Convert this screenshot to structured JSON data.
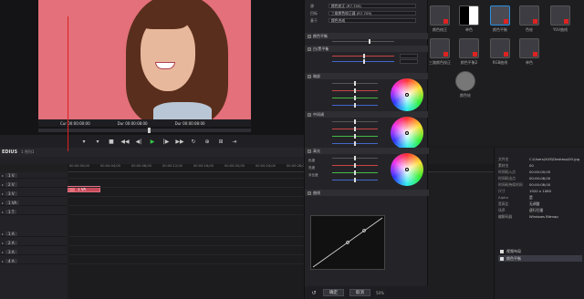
{
  "preview": {
    "in_label": "Cur 00:00:00:00",
    "out_label": "Dur 00:00:08:00",
    "right_label": "Dur 00:00:08:00"
  },
  "timeline": {
    "project_label": "EDIUS",
    "sequence_label": "1 序列1",
    "ruler_ticks": [
      "00:00:00;00",
      "00:00:04;00",
      "00:00:08;00",
      "00:00:12;00",
      "00:00:16;00",
      "00:00:20;00",
      "00:00:24;00",
      "00:00:28;00"
    ],
    "tracks": [
      "1 V",
      "2 V",
      "3 V",
      "1 VA",
      "1 T",
      "1 A",
      "2 A",
      "3 A",
      "4 A"
    ],
    "clip_name": "1 VA"
  },
  "fx_panel": {
    "rows": [
      {
        "name": "源",
        "value": "颜色校正 (R7.709)"
      },
      {
        "name": "目标",
        "value": "三维颜色校正器 (R7.709)"
      },
      {
        "name": "基于",
        "value": "颜色合成"
      }
    ],
    "sections": [
      "颜色平衡",
      "白/黑平衡",
      "暗部",
      "中间调",
      "高光",
      "曲线"
    ],
    "balance_labels": [
      "色度",
      "亮度",
      "对比度"
    ],
    "footer_ok": "确定",
    "footer_cancel": "取消",
    "zoom": "50%"
  },
  "palette": {
    "items": [
      "颜色校正",
      "单色",
      "颜色平衡",
      "色轮",
      "YUV曲线",
      "三路颜色校正",
      "颜色平衡2",
      "RGB曲线",
      "单色",
      "颜色轮"
    ]
  },
  "inspector": {
    "props": [
      {
        "k": "文件名",
        "v": "C:\\Users\\XUS\\Desktop\\00.jpg"
      },
      {
        "k": "素材名",
        "v": "00"
      },
      {
        "k": "时间码入点",
        "v": "00:00:00;00"
      },
      {
        "k": "时间码出点",
        "v": "00:00:08;00"
      },
      {
        "k": "时间码持续时间",
        "v": "00:00:08;00"
      },
      {
        "k": "尺寸",
        "v": "1920 x 1080"
      },
      {
        "k": "Alpha",
        "v": "是"
      },
      {
        "k": "宽高比",
        "v": "无调整"
      },
      {
        "k": "场序",
        "v": "逐行扫描"
      },
      {
        "k": "编解码器",
        "v": "Windows Bitmap"
      }
    ],
    "fx_items": [
      "视频布局",
      "颜色平衡"
    ]
  },
  "colors": {
    "accent": "#2b8fe0",
    "video_bg": "#e3707a",
    "clip": "#c74a5a",
    "play": "#36c94a"
  }
}
